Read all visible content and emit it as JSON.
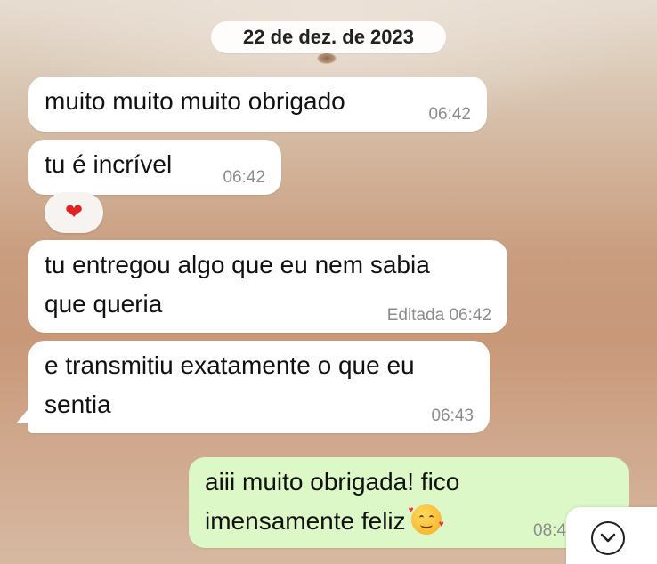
{
  "chat": {
    "date_separator": "22 de dez. de 2023",
    "messages": [
      {
        "direction": "incoming",
        "text": "muito muito muito obrigado",
        "time": "06:42"
      },
      {
        "direction": "incoming",
        "text": "tu é incrível",
        "time": "06:42",
        "reaction": "❤️"
      },
      {
        "direction": "incoming",
        "text": "tu entregou algo que eu nem sabia\nque queria",
        "edited_label": "Editada",
        "time": "06:42"
      },
      {
        "direction": "incoming",
        "text": "e transmitiu exatamente o que eu\nsentia",
        "time": "06:43"
      },
      {
        "direction": "outgoing",
        "text": "aiii muito obrigada! fico\nimensamente feliz",
        "emoji": "smiling-face-with-hearts",
        "time": "08:4"
      }
    ]
  },
  "reaction_heart": "❤",
  "colors": {
    "incoming_bubble": "#ffffff",
    "outgoing_bubble": "#dcf8c6",
    "timestamp": "#8c8c8c"
  },
  "icons": {
    "scroll_down": "chevron-down-circle-icon"
  }
}
